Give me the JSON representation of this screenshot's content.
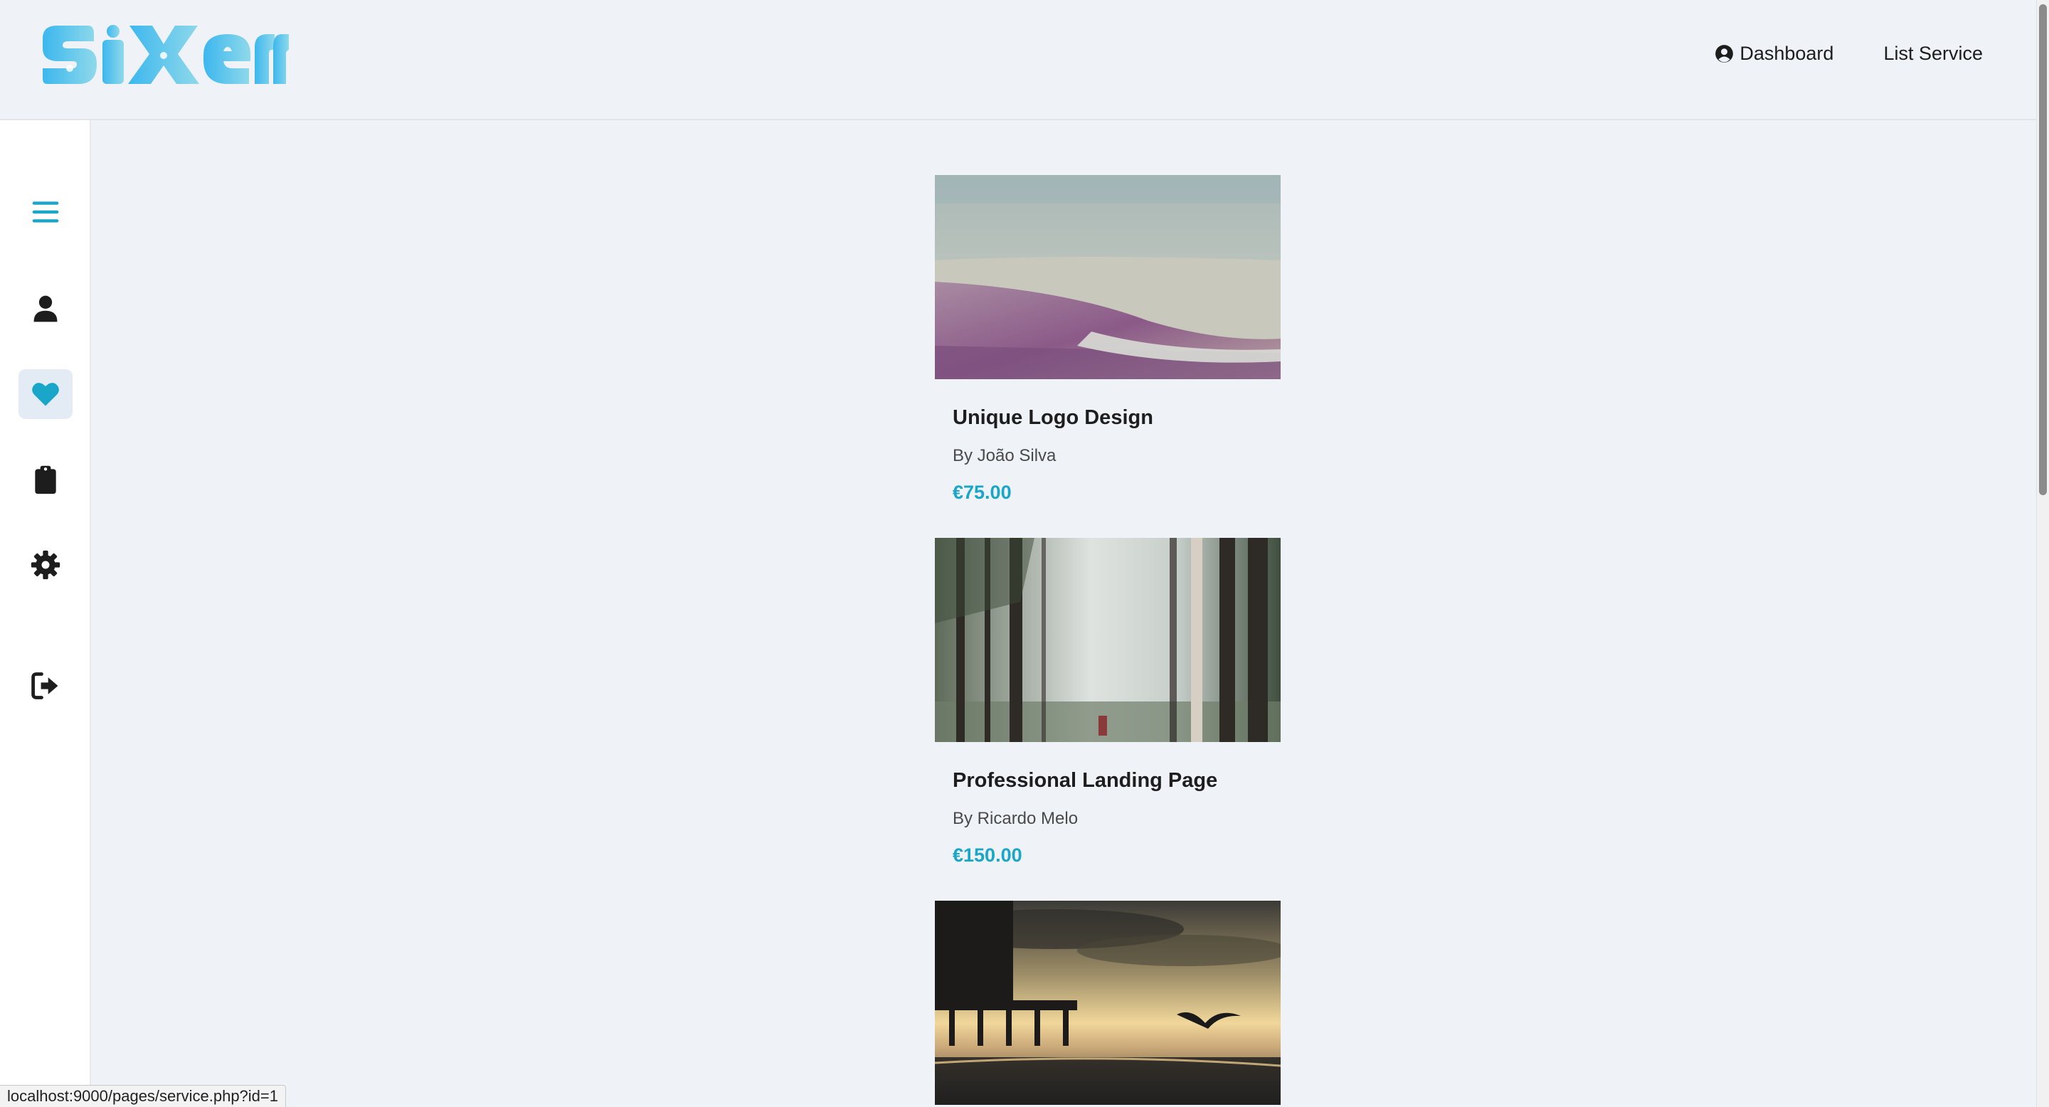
{
  "app": {
    "logo_text": "sixerr",
    "accent_color": "#1aa6c9"
  },
  "header": {
    "nav": {
      "dashboard_label": "Dashboard",
      "list_service_label": "List Service"
    }
  },
  "sidebar": {
    "items": [
      {
        "name": "menu",
        "icon": "hamburger-menu-icon"
      },
      {
        "name": "profile",
        "icon": "user-icon"
      },
      {
        "name": "favorites",
        "icon": "heart-icon",
        "active": true
      },
      {
        "name": "orders",
        "icon": "clipboard-icon"
      },
      {
        "name": "settings",
        "icon": "gear-icon"
      },
      {
        "name": "logout",
        "icon": "logout-icon"
      }
    ]
  },
  "services": [
    {
      "title": "Unique Logo Design",
      "author": "By João Silva",
      "price": "€75.00",
      "image": "beach-photo"
    },
    {
      "title": "Professional Landing Page",
      "author": "By Ricardo Melo",
      "price": "€150.00",
      "image": "forest-photo"
    },
    {
      "image": "pier-sunset-photo"
    }
  ],
  "status_bar": {
    "url": "localhost:9000/pages/service.php?id=1"
  }
}
